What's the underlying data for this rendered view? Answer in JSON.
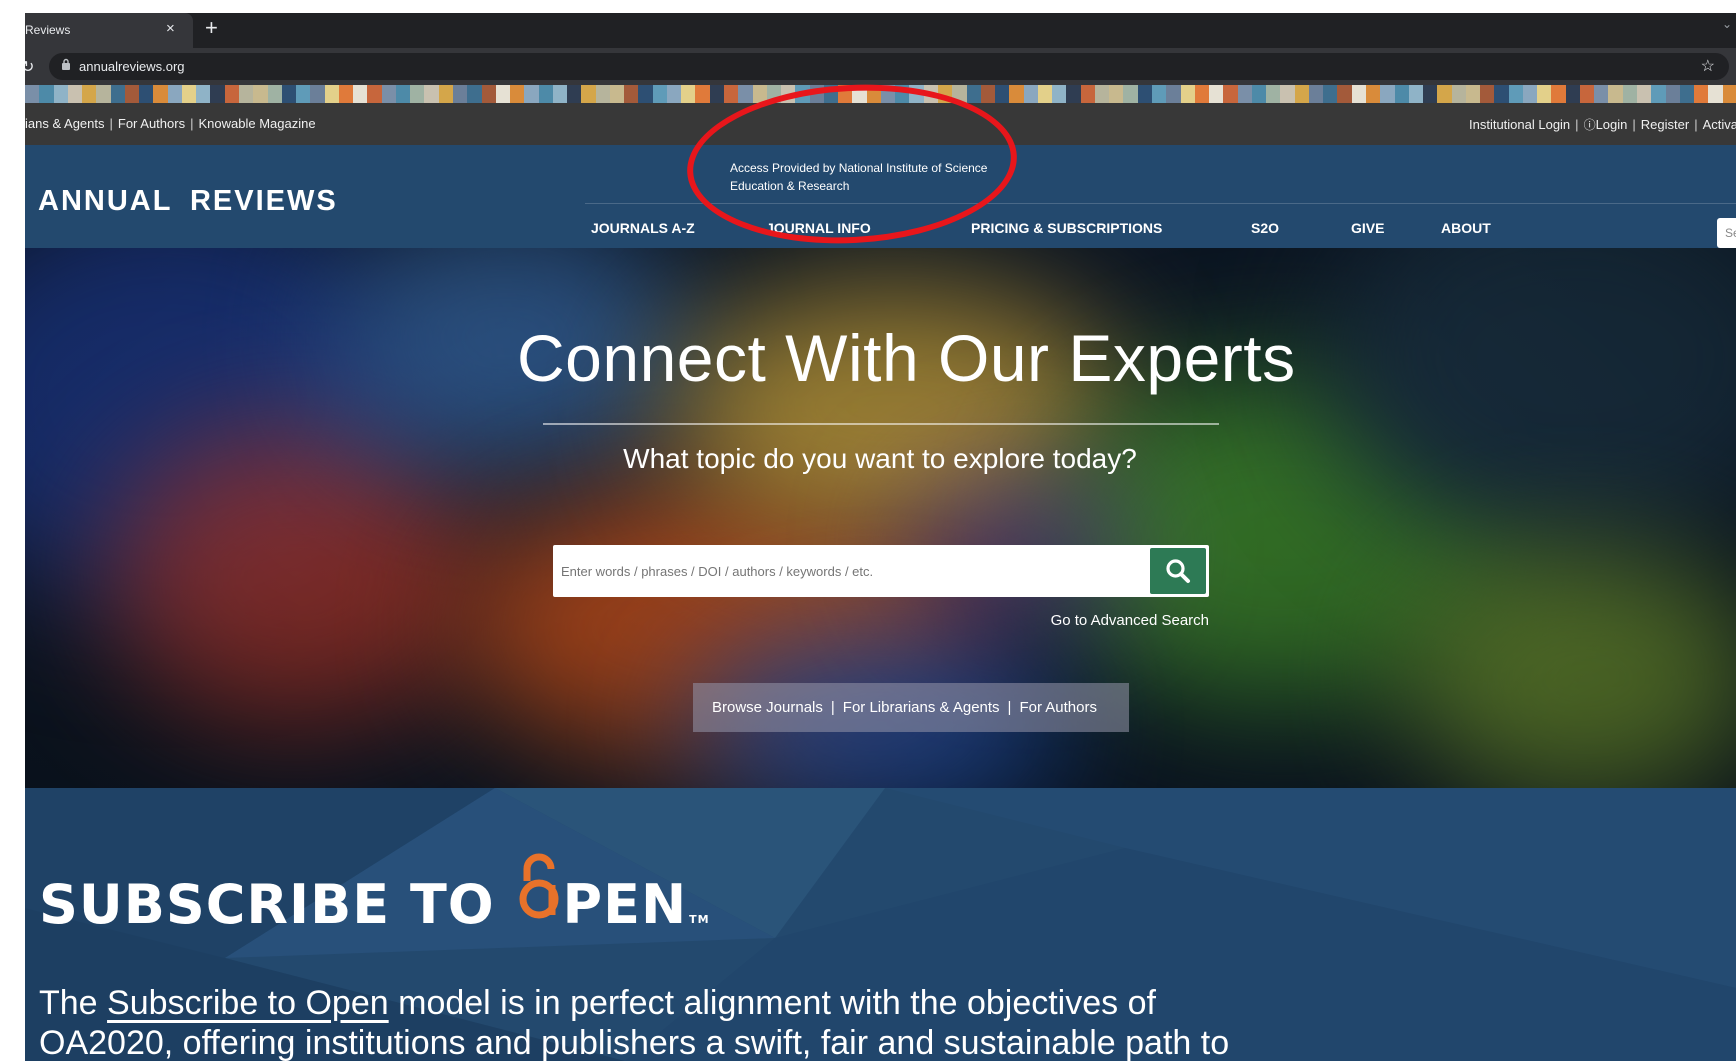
{
  "browser": {
    "tab_title": "Reviews",
    "tab_close": "×",
    "new_tab": "+",
    "url": "annualreviews.org"
  },
  "util_bar": {
    "left_links": [
      "ians & Agents",
      "For Authors",
      "Knowable Magazine"
    ],
    "right_links": [
      "Institutional Login",
      "Login",
      "Register",
      "Activa"
    ]
  },
  "header": {
    "logo": "ANNUAL  REVIEWS",
    "access_line1": "Access Provided by National Institute of Science",
    "access_line2": "Education & Research",
    "search_placeholder": "Se"
  },
  "nav": [
    "JOURNALS A-Z",
    "JOURNAL INFO",
    "PRICING & SUBSCRIPTIONS",
    "S2O",
    "GIVE",
    "ABOUT"
  ],
  "hero": {
    "title": "Connect With Our Experts",
    "subtitle": "What topic do you want to explore today?",
    "search_placeholder": "Enter words / phrases / DOI / authors / keywords / etc.",
    "advanced_search": "Go to Advanced Search",
    "links": [
      "Browse Journals",
      "For Librarians & Agents",
      "For Authors"
    ]
  },
  "s2o": {
    "logo_left": "SUBSCRIBE TO",
    "logo_right": "PEN",
    "logo_tm": "TM",
    "text_pre": "The ",
    "text_link": "Subscribe to Open",
    "text_post": " model is in perfect alignment with the objectives of OA2020, offering institutions and publishers a swift, fair and sustainable path to transitioning"
  },
  "colors": {
    "header_blue": "#23496e",
    "util_bar": "#383838",
    "search_button": "#2d7a55",
    "annotation_red": "#e8161b",
    "s2o_orange": "#e8722a"
  },
  "icons": [
    "reload-icon",
    "lock-icon",
    "star-icon",
    "user-circle-icon",
    "search-icon",
    "open-access-lock-icon"
  ]
}
